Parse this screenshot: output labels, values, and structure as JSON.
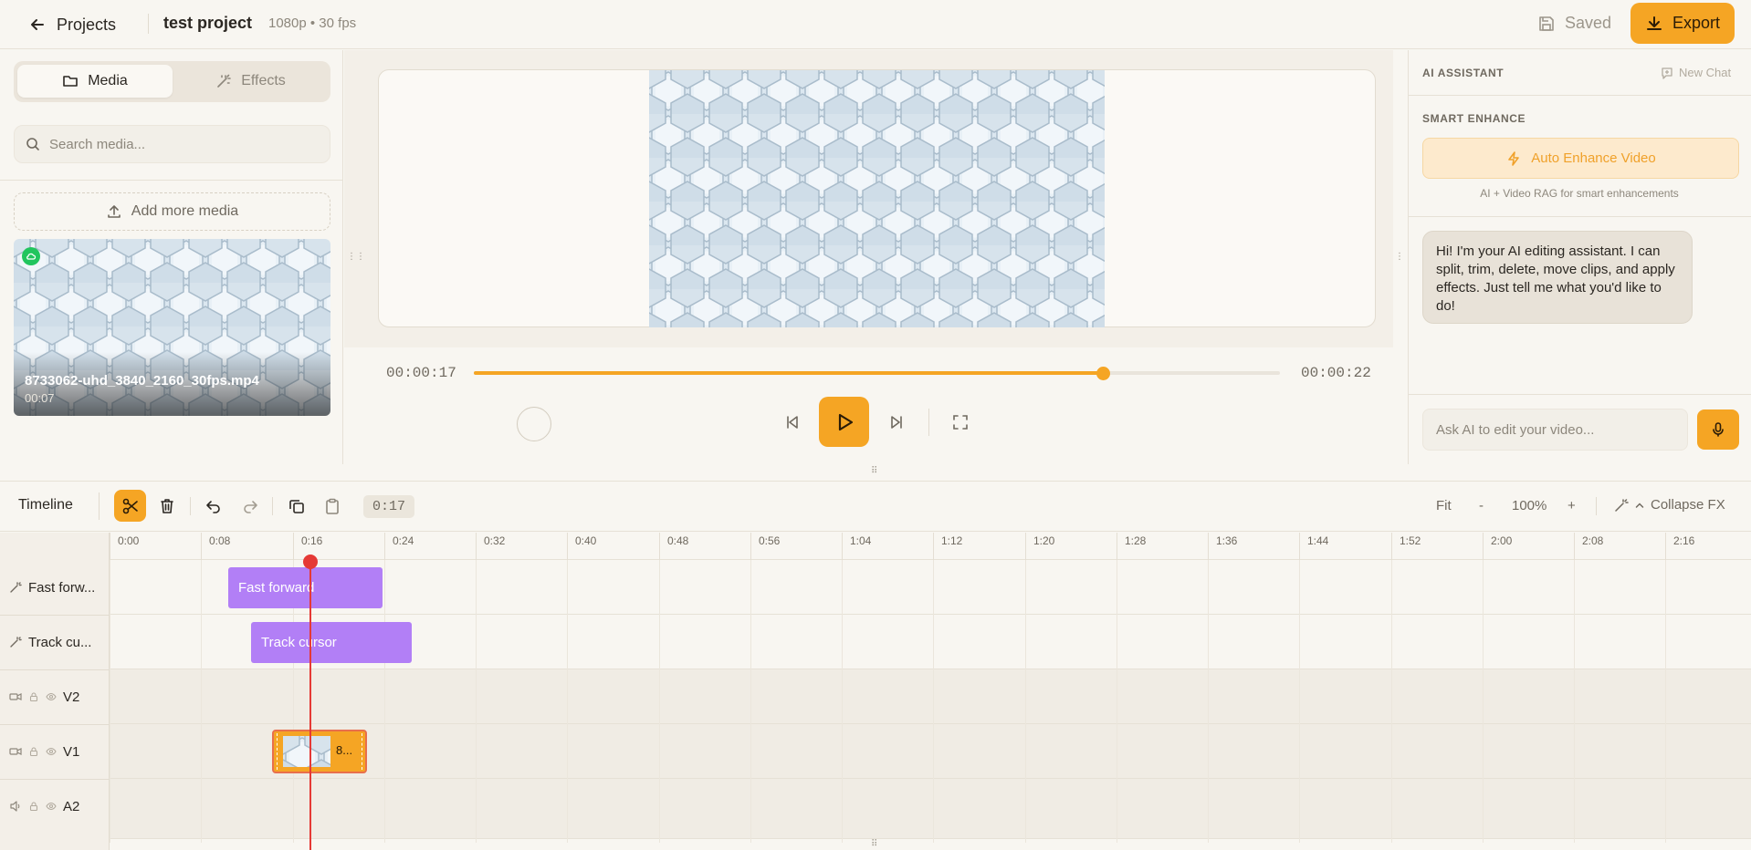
{
  "header": {
    "back_label": "Projects",
    "project_title": "test project",
    "project_meta": "1080p • 30 fps",
    "saved_label": "Saved",
    "export_label": "Export"
  },
  "left_panel": {
    "tabs": [
      {
        "label": "Media",
        "active": true
      },
      {
        "label": "Effects",
        "active": false
      }
    ],
    "search_placeholder": "Search media...",
    "add_media_label": "Add more media",
    "media_items": [
      {
        "filename": "8733062-uhd_3840_2160_30fps.mp4",
        "duration": "00:07"
      }
    ]
  },
  "preview": {
    "current_time": "00:00:17",
    "total_time": "00:00:22",
    "progress": 0.78
  },
  "assistant": {
    "title": "AI ASSISTANT",
    "new_chat_label": "New Chat",
    "smart_enhance_label": "SMART ENHANCE",
    "auto_enhance_label": "Auto Enhance Video",
    "auto_enhance_sub": "AI + Video RAG for smart enhancements",
    "message": "Hi! I'm your AI editing assistant. I can split, trim, delete, move clips, and apply effects. Just tell me what you'd like to do!",
    "input_placeholder": "Ask AI to edit your video..."
  },
  "timeline": {
    "title": "Timeline",
    "timecode": "0:17",
    "fit_label": "Fit",
    "zoom_minus": "-",
    "zoom_level": "100%",
    "zoom_plus": "+",
    "collapse_label": "Collapse FX",
    "ticks": [
      "0:00",
      "0:08",
      "0:16",
      "0:24",
      "0:32",
      "0:40",
      "0:48",
      "0:56",
      "1:04",
      "1:12",
      "1:20",
      "1:28",
      "1:36",
      "1:44",
      "1:52",
      "2:00",
      "2:08",
      "2:16"
    ],
    "tracks": [
      {
        "name": "Fast forw...",
        "type": "fx"
      },
      {
        "name": "Track cu...",
        "type": "fx"
      },
      {
        "name": "V2",
        "type": "video"
      },
      {
        "name": "V1",
        "type": "video"
      },
      {
        "name": "A2",
        "type": "audio"
      }
    ],
    "fx_clips": [
      {
        "label": "Fast forward",
        "track": 0
      },
      {
        "label": "Track cursor",
        "track": 1
      }
    ],
    "video_clip": {
      "label": "8...",
      "track": "V1"
    }
  },
  "colors": {
    "accent": "#f5a524",
    "fx_clip": "#b27ff6",
    "playhead": "#e53935",
    "cloud_badge": "#22c55e"
  }
}
